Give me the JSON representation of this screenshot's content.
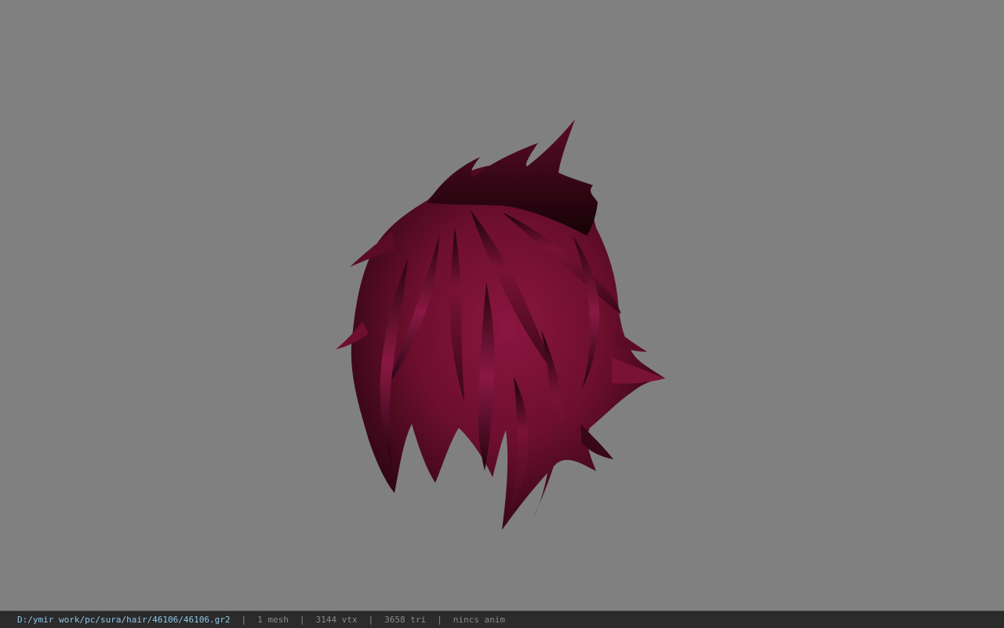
{
  "viewer": {
    "background_color": "#808080",
    "model": {
      "name": "hair-mesh",
      "base_color": "#6e0f2e",
      "shadow_color": "#1a0309"
    }
  },
  "status_bar": {
    "file_path": "D:/ymir work/pc/sura/hair/46106/46106.gr2",
    "mesh_count": "1 mesh",
    "vertex_count": "3144 vtx",
    "triangle_count": "3658 tri",
    "anim_status": "nincs anim",
    "separator": "|",
    "path_color": "#8ec7e8",
    "text_color": "#8a8a8a"
  }
}
